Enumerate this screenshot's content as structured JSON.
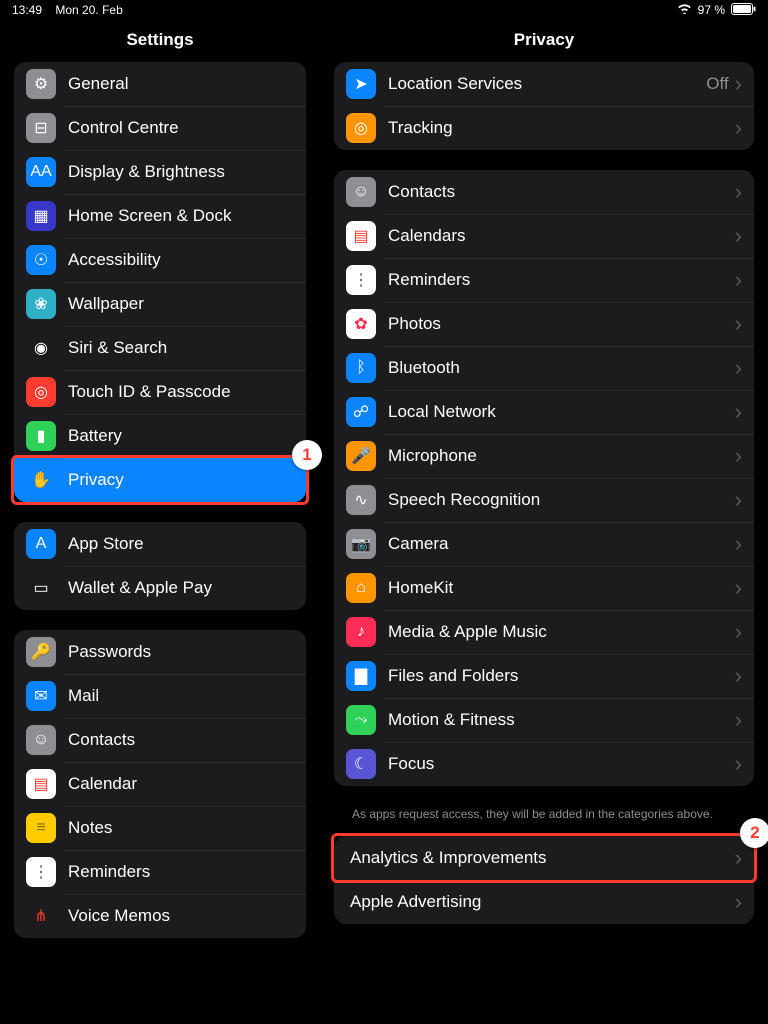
{
  "status": {
    "time": "13:49",
    "date": "Mon 20. Feb",
    "battery_pct": "97 %"
  },
  "sidebar": {
    "title": "Settings",
    "groups": [
      {
        "items": [
          {
            "id": "general",
            "label": "General",
            "icon_bg": "#8e8e93",
            "glyph": "⚙"
          },
          {
            "id": "control-centre",
            "label": "Control Centre",
            "icon_bg": "#8e8e93",
            "glyph": "⊟"
          },
          {
            "id": "display",
            "label": "Display & Brightness",
            "icon_bg": "#0a84ff",
            "glyph": "AA"
          },
          {
            "id": "home-screen",
            "label": "Home Screen & Dock",
            "icon_bg": "#3737c8",
            "glyph": "▦"
          },
          {
            "id": "accessibility",
            "label": "Accessibility",
            "icon_bg": "#0a84ff",
            "glyph": "☉"
          },
          {
            "id": "wallpaper",
            "label": "Wallpaper",
            "icon_bg": "#30b0c7",
            "glyph": "❀"
          },
          {
            "id": "siri",
            "label": "Siri & Search",
            "icon_bg": "#1c1c1e",
            "glyph": "◉"
          },
          {
            "id": "touchid",
            "label": "Touch ID & Passcode",
            "icon_bg": "#ff3b30",
            "glyph": "◎"
          },
          {
            "id": "battery",
            "label": "Battery",
            "icon_bg": "#30d158",
            "glyph": "▮"
          },
          {
            "id": "privacy",
            "label": "Privacy",
            "icon_bg": "#0a84ff",
            "glyph": "✋",
            "selected": true
          }
        ]
      },
      {
        "items": [
          {
            "id": "app-store",
            "label": "App Store",
            "icon_bg": "#0a84ff",
            "glyph": "A"
          },
          {
            "id": "wallet",
            "label": "Wallet & Apple Pay",
            "icon_bg": "#1c1c1e",
            "glyph": "▭"
          }
        ]
      },
      {
        "items": [
          {
            "id": "passwords",
            "label": "Passwords",
            "icon_bg": "#8e8e93",
            "glyph": "🔑"
          },
          {
            "id": "mail",
            "label": "Mail",
            "icon_bg": "#0a84ff",
            "glyph": "✉"
          },
          {
            "id": "contacts-s",
            "label": "Contacts",
            "icon_bg": "#8e8e93",
            "glyph": "☺"
          },
          {
            "id": "calendar-s",
            "label": "Calendar",
            "icon_bg": "#ffffff",
            "glyph": "▤",
            "glyph_color": "#ff3b30"
          },
          {
            "id": "notes",
            "label": "Notes",
            "icon_bg": "#ffcc00",
            "glyph": "≡",
            "glyph_color": "#8a6d00"
          },
          {
            "id": "reminders-s",
            "label": "Reminders",
            "icon_bg": "#ffffff",
            "glyph": "⋮",
            "glyph_color": "#555"
          },
          {
            "id": "voice-memos",
            "label": "Voice Memos",
            "icon_bg": "#1c1c1e",
            "glyph": "⋔",
            "glyph_color": "#ff3b30"
          }
        ]
      }
    ]
  },
  "detail": {
    "title": "Privacy",
    "groups": [
      {
        "items": [
          {
            "id": "location",
            "label": "Location Services",
            "value": "Off",
            "icon_bg": "#0a84ff",
            "glyph": "➤"
          },
          {
            "id": "tracking",
            "label": "Tracking",
            "icon_bg": "#ff9500",
            "glyph": "◎"
          }
        ]
      },
      {
        "items": [
          {
            "id": "contacts",
            "label": "Contacts",
            "icon_bg": "#8e8e93",
            "glyph": "☺"
          },
          {
            "id": "calendars",
            "label": "Calendars",
            "icon_bg": "#ffffff",
            "glyph": "▤",
            "glyph_color": "#ff3b30"
          },
          {
            "id": "reminders",
            "label": "Reminders",
            "icon_bg": "#ffffff",
            "glyph": "⋮",
            "glyph_color": "#555"
          },
          {
            "id": "photos",
            "label": "Photos",
            "icon_bg": "#ffffff",
            "glyph": "✿",
            "glyph_color": "#ff2d55"
          },
          {
            "id": "bluetooth",
            "label": "Bluetooth",
            "icon_bg": "#0a84ff",
            "glyph": "ᛒ"
          },
          {
            "id": "localnet",
            "label": "Local Network",
            "icon_bg": "#0a84ff",
            "glyph": "☍"
          },
          {
            "id": "microphone",
            "label": "Microphone",
            "icon_bg": "#ff9500",
            "glyph": "🎤"
          },
          {
            "id": "speech",
            "label": "Speech Recognition",
            "icon_bg": "#8e8e93",
            "glyph": "∿"
          },
          {
            "id": "camera",
            "label": "Camera",
            "icon_bg": "#8e8e93",
            "glyph": "📷"
          },
          {
            "id": "homekit",
            "label": "HomeKit",
            "icon_bg": "#ff9500",
            "glyph": "⌂"
          },
          {
            "id": "media",
            "label": "Media & Apple Music",
            "icon_bg": "#ff2d55",
            "glyph": "♪"
          },
          {
            "id": "files",
            "label": "Files and Folders",
            "icon_bg": "#0a84ff",
            "glyph": "▇"
          },
          {
            "id": "motion",
            "label": "Motion & Fitness",
            "icon_bg": "#30d158",
            "glyph": "⤳"
          },
          {
            "id": "focus",
            "label": "Focus",
            "icon_bg": "#5856d6",
            "glyph": "☾"
          }
        ],
        "footer": "As apps request access, they will be added in the categories above."
      },
      {
        "items": [
          {
            "id": "analytics",
            "label": "Analytics & Improvements"
          },
          {
            "id": "advertising",
            "label": "Apple Advertising"
          }
        ]
      }
    ]
  },
  "callouts": {
    "c1": "1",
    "c2": "2"
  }
}
